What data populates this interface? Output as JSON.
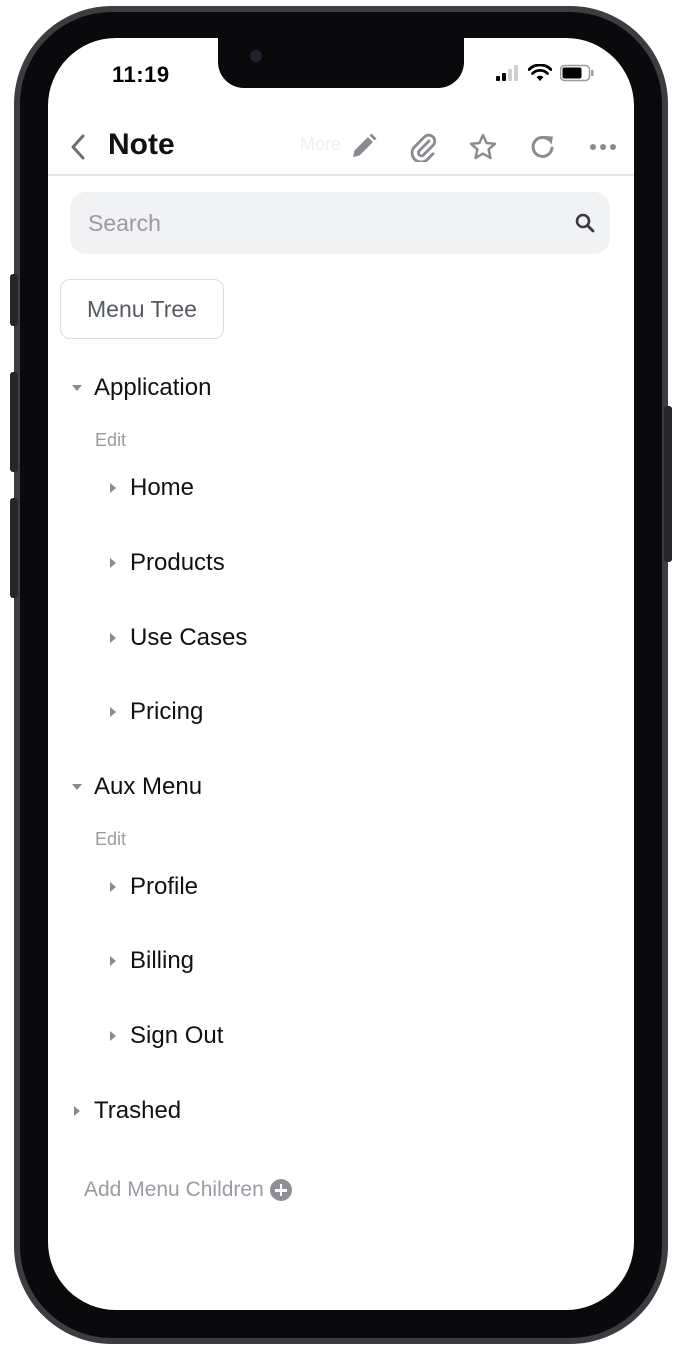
{
  "status_bar": {
    "time": "11:19",
    "icons": [
      "signal-icon",
      "wifi-icon",
      "battery-icon"
    ]
  },
  "header": {
    "title": "Note",
    "faint_label": "More",
    "actions": [
      "pencil-icon",
      "paperclip-icon",
      "star-icon",
      "refresh-icon",
      "more-icon"
    ]
  },
  "search": {
    "placeholder": "Search",
    "value": ""
  },
  "menu_tree_button": {
    "label": "Menu Tree"
  },
  "tree": {
    "groups": [
      {
        "label": "Application",
        "expanded": true,
        "edit_label": "Edit",
        "children": [
          "Home",
          "Products",
          "Use Cases",
          "Pricing"
        ]
      },
      {
        "label": "Aux Menu",
        "expanded": true,
        "edit_label": "Edit",
        "children": [
          "Profile",
          "Billing",
          "Sign Out"
        ]
      },
      {
        "label": "Trashed",
        "expanded": false
      }
    ]
  },
  "add_children": {
    "label": "Add Menu Children",
    "icon": "plus-circle-icon"
  },
  "colors": {
    "accent_gray": "#8a8a90",
    "text": "#111111",
    "search_bg": "#f1f2f4"
  }
}
